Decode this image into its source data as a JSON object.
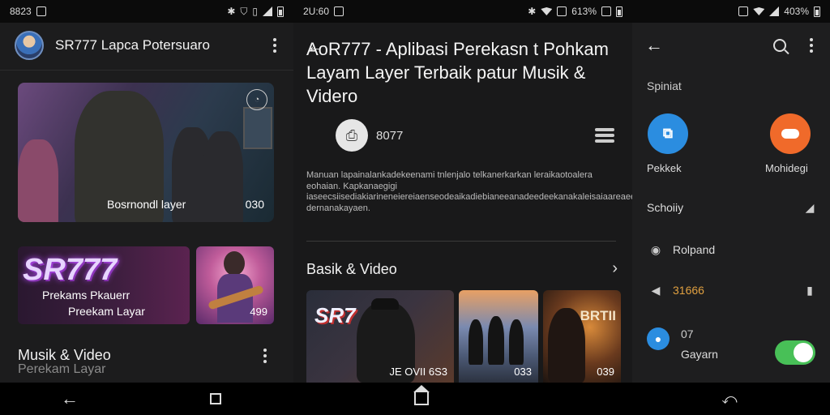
{
  "screen1": {
    "status": {
      "time": "8823"
    },
    "header": {
      "title": "SR777 Lapca Potersuaro"
    },
    "hero": {
      "caption": "Bosrnondl layer",
      "duration": "030"
    },
    "tile_a": {
      "brand": "SR777",
      "line1": "Prekams Pkauerr",
      "line2": "Preekam Layar"
    },
    "tile_b": {
      "duration": "499"
    },
    "section": {
      "title": "Musik & Video",
      "subtitle": "Perekam Layar"
    }
  },
  "screen2": {
    "status": {
      "time": "2U:60",
      "battery": "613%"
    },
    "title": "AoR777 - Aplibasi Perekasn t Pohkam Layam Layer Terbaik patur Musik & Videro",
    "app": {
      "name": "8077"
    },
    "description": "Manuan lapainalankadekeenami tnlenjalo telkanerkarkan leraikaotoalera eohaian. Kapkanaegigi iaseecsiisediakiarineneiereiaenseodeaikadiebianeeanadeedeekanakaleisaiaareaeeaaeiedenkadeecieanhaiitordetangalterigaire dernanakayaen.",
    "section": {
      "title": "Basik & Video"
    },
    "thumbs": [
      {
        "brand": "SR7",
        "caption": "JE OVII 6S3"
      },
      {
        "caption": "033"
      },
      {
        "brand": "BRTII",
        "caption": "039"
      }
    ]
  },
  "screen3": {
    "status": {
      "battery": "403%"
    },
    "header": {
      "label": "Spiniat"
    },
    "apps": [
      {
        "label": "Pekkek",
        "icon": "contacts-icon",
        "color": "#2b8de0"
      },
      {
        "label": "Mohidegi",
        "icon": "chat-bubble-icon",
        "color": "#f06a2a"
      }
    ],
    "schedule": {
      "label": "Schoiiy"
    },
    "items": [
      {
        "label": "Rolpand"
      },
      {
        "label": "31666"
      },
      {
        "label": "Gayarn",
        "number": "07",
        "toggle": true
      }
    ]
  }
}
